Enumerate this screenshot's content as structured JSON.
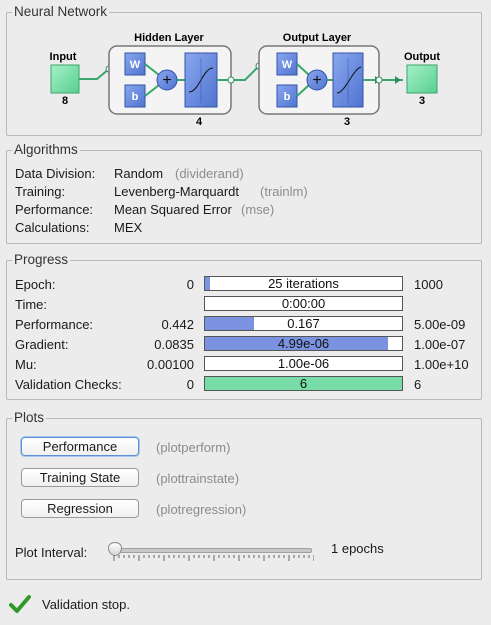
{
  "network": {
    "title": "Neural Network",
    "input_label": "Input",
    "input_size": "8",
    "hidden_label": "Hidden Layer",
    "hidden_size": "4",
    "output_layer_label": "Output Layer",
    "output_layer_size": "3",
    "output_label": "Output",
    "output_size": "3",
    "w_label": "W",
    "b_label": "b"
  },
  "algorithms": {
    "title": "Algorithms",
    "rows": [
      {
        "label": "Data Division:",
        "value": "Random",
        "fn": "(dividerand)"
      },
      {
        "label": "Training:",
        "value": "Levenberg-Marquardt",
        "fn": "(trainlm)"
      },
      {
        "label": "Performance:",
        "value": "Mean Squared Error",
        "fn": "(mse)"
      },
      {
        "label": "Calculations:",
        "value": "MEX",
        "fn": ""
      }
    ]
  },
  "progress": {
    "title": "Progress",
    "rows": [
      {
        "label": "Epoch:",
        "start": "0",
        "current": "25 iterations",
        "end": "1000",
        "fill": 0.025
      },
      {
        "label": "Time:",
        "start": "",
        "current": "0:00:00",
        "end": "",
        "fill": 0
      },
      {
        "label": "Performance:",
        "start": "0.442",
        "current": "0.167",
        "end": "5.00e-09",
        "fill": 0.25
      },
      {
        "label": "Gradient:",
        "start": "0.0835",
        "current": "4.99e-06",
        "end": "1.00e-07",
        "fill": 0.93
      },
      {
        "label": "Mu:",
        "start": "0.00100",
        "current": "1.00e-06",
        "end": "1.00e+10",
        "fill": 0
      },
      {
        "label": "Validation Checks:",
        "start": "0",
        "current": "6",
        "end": "6",
        "fill": 1.0
      }
    ]
  },
  "plots": {
    "title": "Plots",
    "buttons": [
      {
        "label": "Performance",
        "fn": "(plotperform)"
      },
      {
        "label": "Training State",
        "fn": "(plottrainstate)"
      },
      {
        "label": "Regression",
        "fn": "(plotregression)"
      }
    ],
    "interval_label": "Plot Interval:",
    "interval_value": "1 epochs"
  },
  "status": {
    "text": "Validation stop."
  },
  "colors": {
    "bar_fill": "#7b92e0",
    "validation_fill": "#78dca8",
    "node_green": "#7de3a7",
    "block_blue": "#6b8de0"
  }
}
